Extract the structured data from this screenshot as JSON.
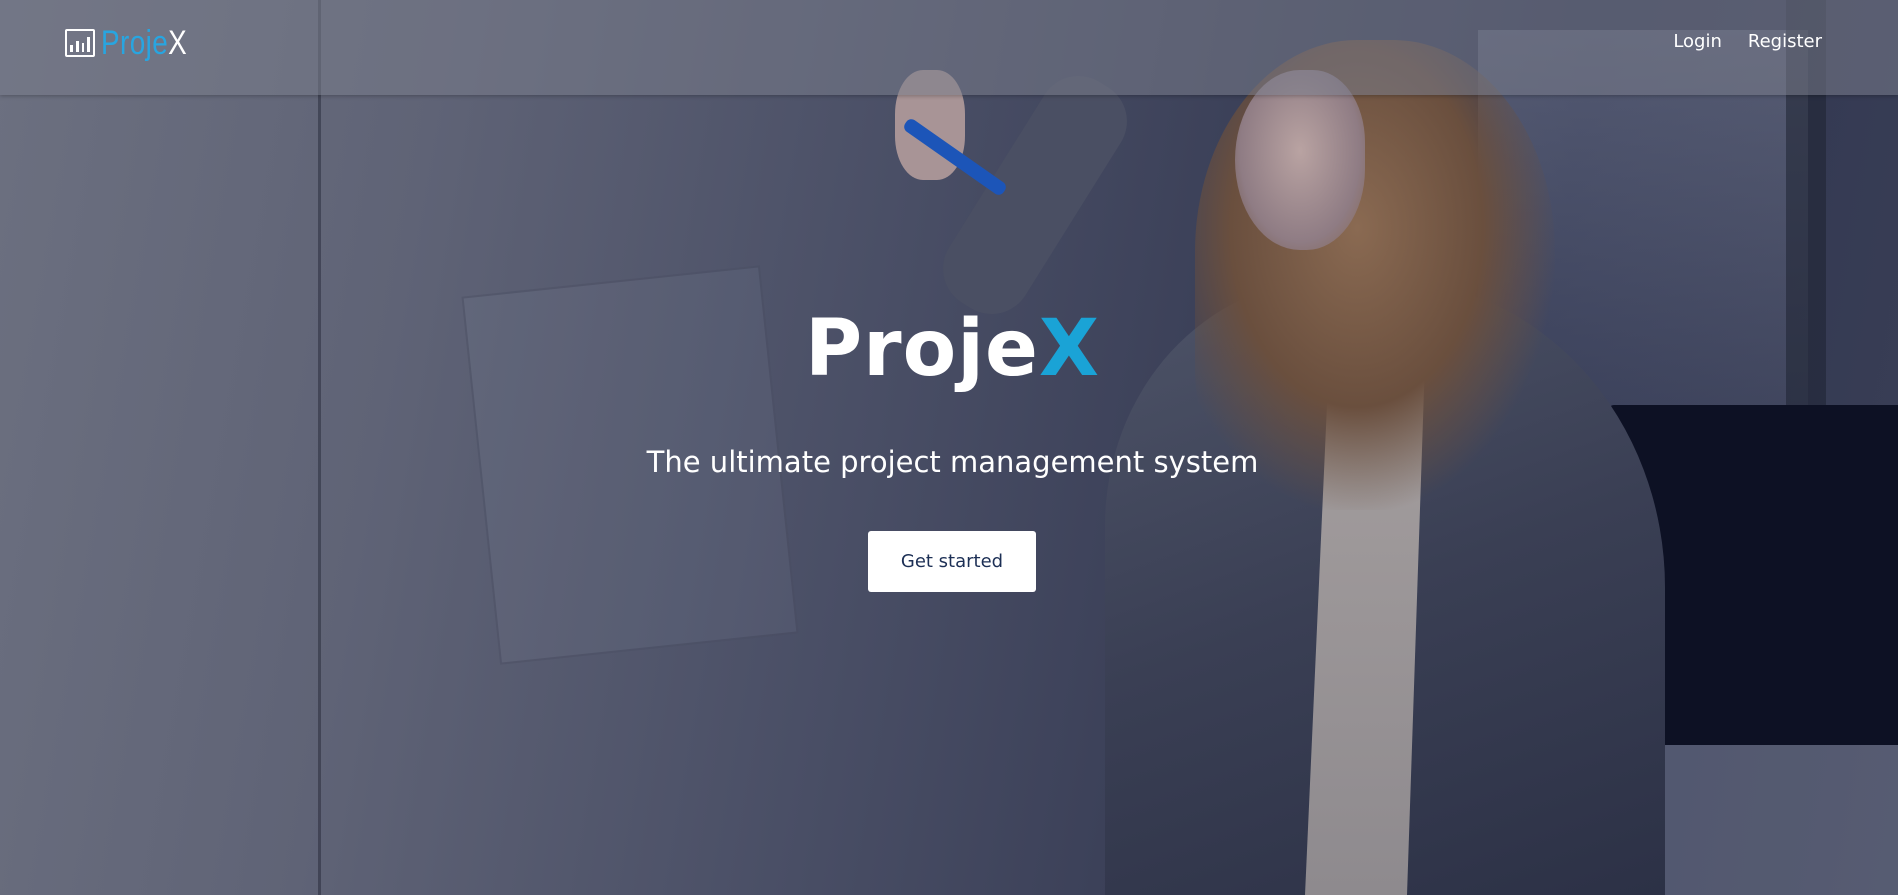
{
  "header": {
    "logo": {
      "text_main": "Proje",
      "text_accent": "X",
      "icon": "bar-chart-icon"
    },
    "nav": [
      {
        "label": "Login"
      },
      {
        "label": "Register"
      }
    ]
  },
  "hero": {
    "title_main": "Proje",
    "title_accent": "X",
    "subtitle": "The ultimate project management system",
    "cta_label": "Get started"
  },
  "colors": {
    "accent": "#1aa3d6",
    "cta_text": "#1c2f55",
    "text": "#ffffff"
  }
}
